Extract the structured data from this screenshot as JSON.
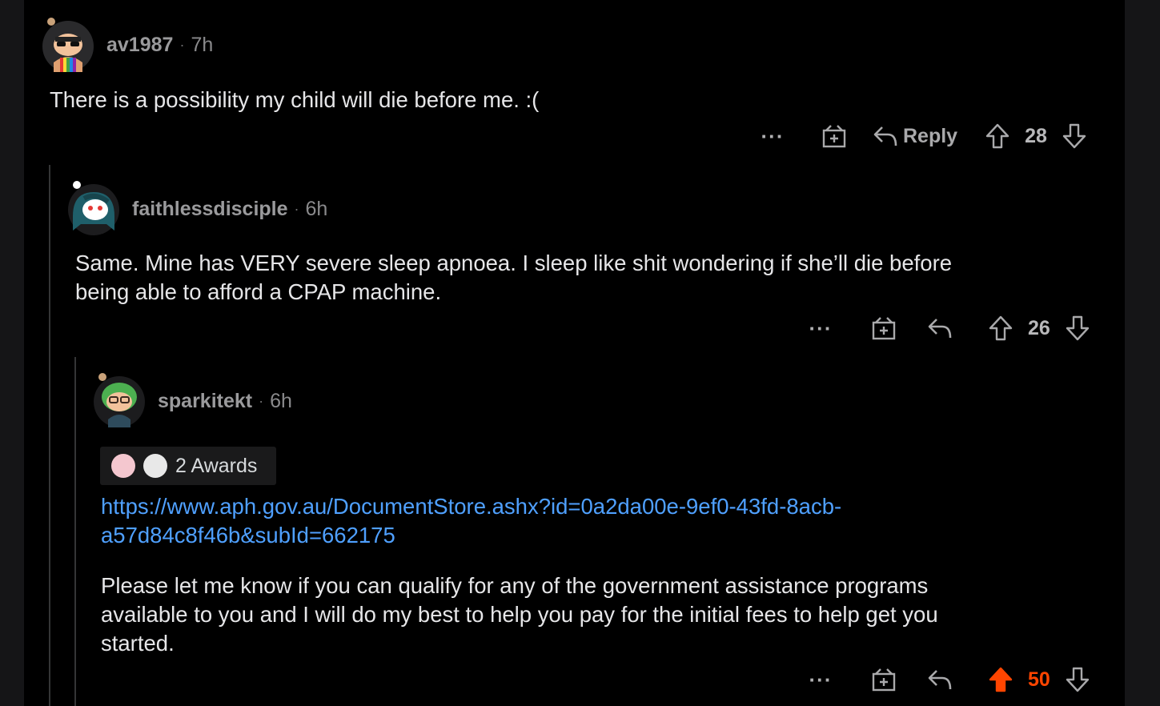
{
  "comments": [
    {
      "username": "av1987",
      "separator": "·",
      "time": "7h",
      "body": [
        "There is a possibility my child will die before me. :("
      ],
      "actions": {
        "more": "···",
        "reply_label": "Reply",
        "score": "28"
      }
    },
    {
      "username": "faithlessdisciple",
      "separator": "·",
      "time": "6h",
      "body": [
        "Same. Mine has VERY severe sleep apnoea. I sleep like shit wondering if she’ll die before",
        "being able to afford a CPAP machine."
      ],
      "actions": {
        "more": "···",
        "score": "26"
      }
    },
    {
      "username": "sparkitekt",
      "separator": "·",
      "time": "6h",
      "awards": {
        "label": "2 Awards"
      },
      "link": [
        "https://www.aph.gov.au/DocumentStore.ashx?id=0a2da00e-9ef0-43fd-8acb-",
        "a57d84c8f46b&subId=662175"
      ],
      "body": [
        "Please let me know if you can qualify for any of the government assistance programs",
        "available to you and I will do my best to help you pay for the initial fees to help get you",
        "started."
      ],
      "actions": {
        "more": "···",
        "score": "50",
        "upvoted": true
      }
    }
  ],
  "colors": {
    "background": "#000000",
    "upvote": "#ff4500",
    "link": "#4fa0ff",
    "text": "#e6e6e8",
    "meta": "#9a9a9c"
  },
  "icons": [
    "more-options-icon",
    "award-gift-icon",
    "reply-arrow-icon",
    "upvote-arrow-icon",
    "downvote-arrow-icon"
  ]
}
